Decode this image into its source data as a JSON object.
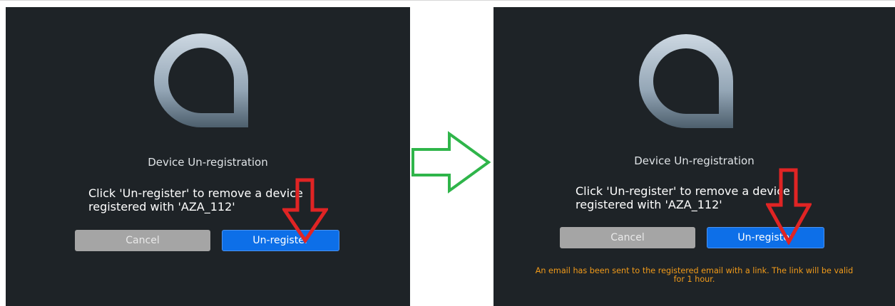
{
  "before": {
    "title": "Device Un-registration",
    "message": "Click 'Un-register' to remove a device\nregistered with 'AZA_112'",
    "cancel_label": "Cancel",
    "unregister_label": "Un-register"
  },
  "after": {
    "title": "Device Un-registration",
    "message": "Click 'Un-register' to remove a device\nregistered with 'AZA_112'",
    "cancel_label": "Cancel",
    "unregister_label": "Un-register",
    "notice": "An email has been sent to the registered email with a link. The link will be valid\nfor 1 hour."
  },
  "colors": {
    "panel_background": "#1e2327",
    "cancel_button": "#a5a5a5",
    "unregister_button": "#0d6fe8",
    "notice_text": "#f09a1a",
    "annotation_arrow": "#e02424",
    "transition_arrow": "#2fb54a"
  },
  "icons": {
    "logo": "drop-ring-logo",
    "annotation": "down-arrow-annotation",
    "transition": "right-arrow"
  }
}
